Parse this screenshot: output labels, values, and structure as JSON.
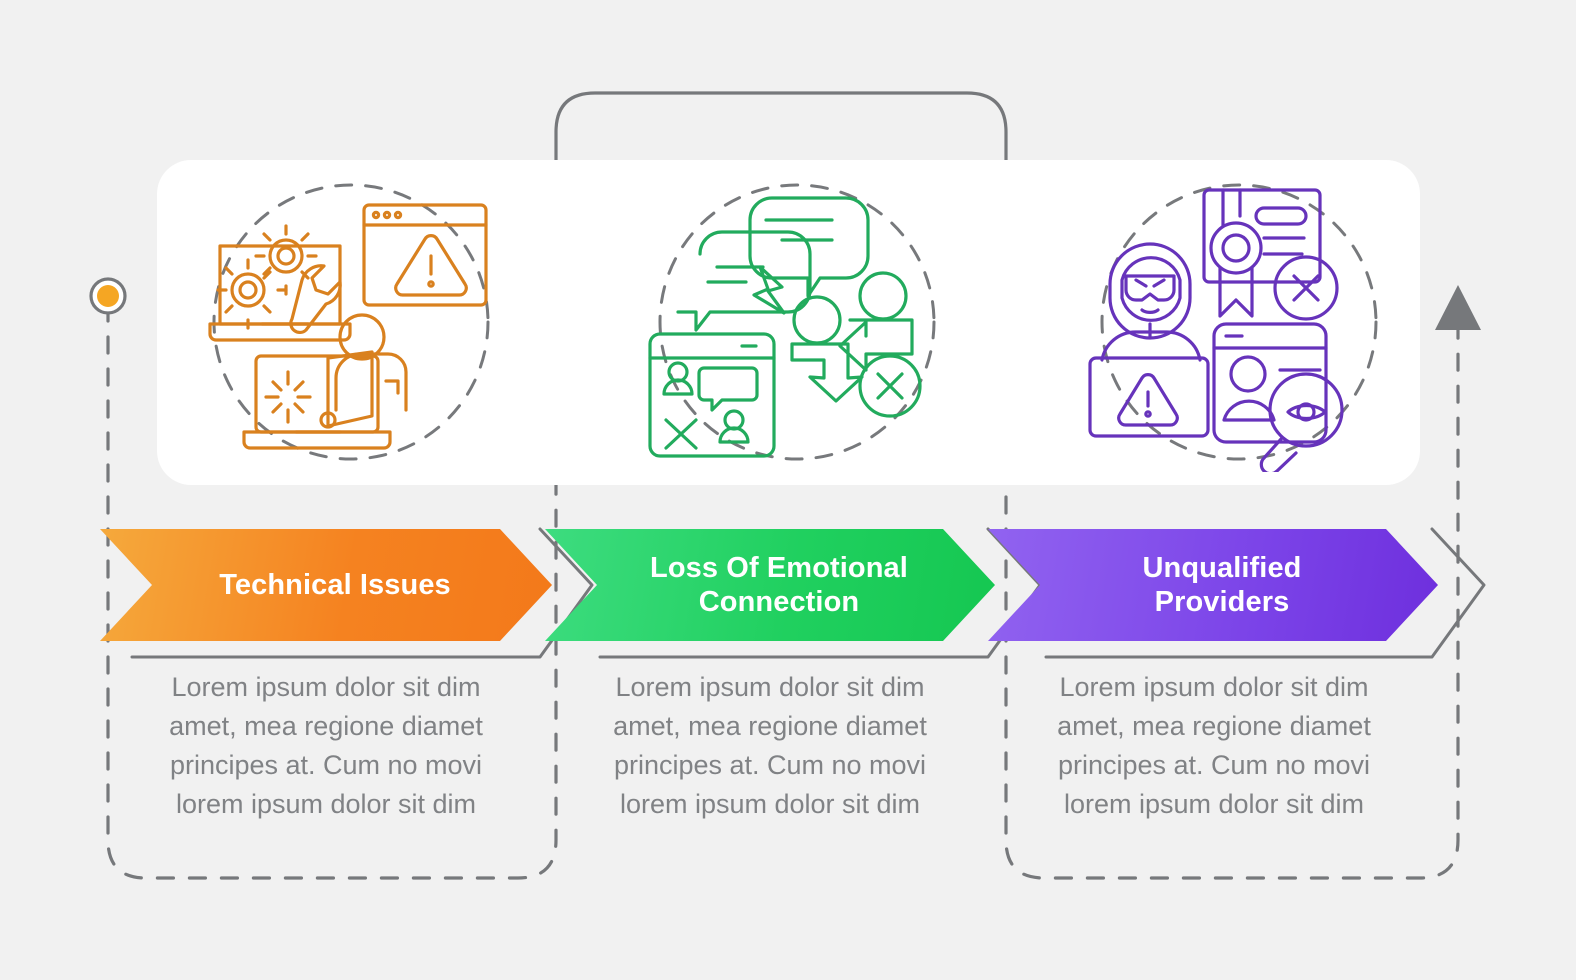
{
  "theme": {
    "background": "#f1f1f1",
    "card_background": "#ffffff",
    "connector_gray": "#76787b",
    "body_text_color": "#808285"
  },
  "steps": [
    {
      "id": "technical-issues",
      "label": "Technical Issues",
      "accent": "#f58220",
      "marker": "circle-dot",
      "description": "Lorem ipsum dolor sit dim amet, mea regione diamet principes at. Cum no movi lorem ipsum dolor sit dim",
      "icons": [
        "laptop-gears-wrench-icon",
        "browser-warning-triangle-icon",
        "person-laptop-loading-icon"
      ]
    },
    {
      "id": "loss-of-emotional-connection",
      "label": "Loss Of Emotional\nConnection",
      "accent": "#20d05f",
      "marker": "circle-dot",
      "description": "Lorem ipsum dolor sit dim amet, mea regione diamet principes at. Cum no movi lorem ipsum dolor sit dim",
      "icons": [
        "broken-chat-bubbles-icon",
        "browser-users-cross-icon",
        "exchange-arrows-cross-icon"
      ]
    },
    {
      "id": "unqualified-providers",
      "label": "Unqualified\nProviders",
      "accent": "#7b43e8",
      "marker": "circle-dot",
      "description": "Lorem ipsum dolor sit dim amet, mea regione diamet principes at. Cum no movi lorem ipsum dolor sit dim",
      "icons": [
        "hooded-hacker-laptop-warning-icon",
        "certificate-cross-icon",
        "profile-magnifier-eye-icon"
      ]
    }
  ],
  "connectors": {
    "end_marker": "arrow-up-triangle",
    "end_marker_color": "#76787b"
  }
}
